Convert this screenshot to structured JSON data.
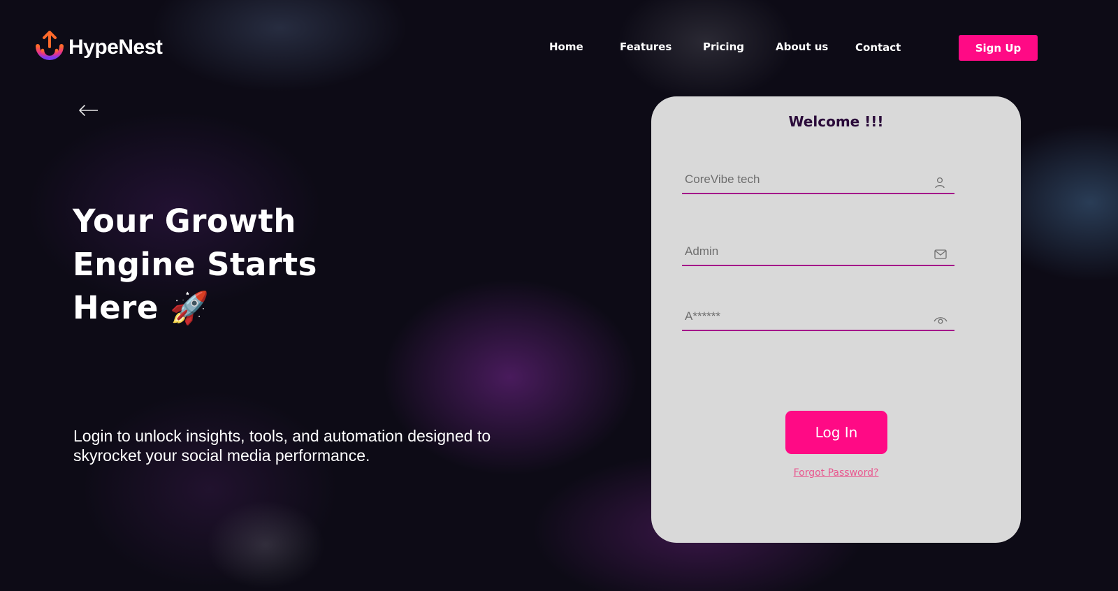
{
  "brand": {
    "name": "HypeNest"
  },
  "nav": {
    "items": [
      {
        "label": "Home"
      },
      {
        "label": "Features"
      },
      {
        "label": "Pricing"
      },
      {
        "label": "About us"
      },
      {
        "label": "Contact"
      }
    ],
    "signup_label": "Sign Up"
  },
  "hero": {
    "title": "Your Growth Engine Starts Here 🚀",
    "subtitle": "Login to unlock insights, tools, and automation designed to skyrocket your social media performance."
  },
  "login": {
    "title": "Welcome !!!",
    "fields": [
      {
        "value": "CoreVibe tech",
        "icon": "user-icon"
      },
      {
        "value": "Admin",
        "icon": "mail-icon"
      },
      {
        "value": "A******",
        "icon": "eye-icon"
      }
    ],
    "submit_label": "Log In",
    "forgot_label": "Forgot Password?"
  },
  "colors": {
    "accent": "#ff0a85",
    "underline": "#a4128a",
    "card": "#d9d9d9",
    "background": "#0d0b16",
    "welcome_text": "#2b0b3a",
    "forgot_link": "#e8588f"
  },
  "icons": {
    "back": "arrow-left-icon",
    "logo": "logo-upload-icon"
  }
}
